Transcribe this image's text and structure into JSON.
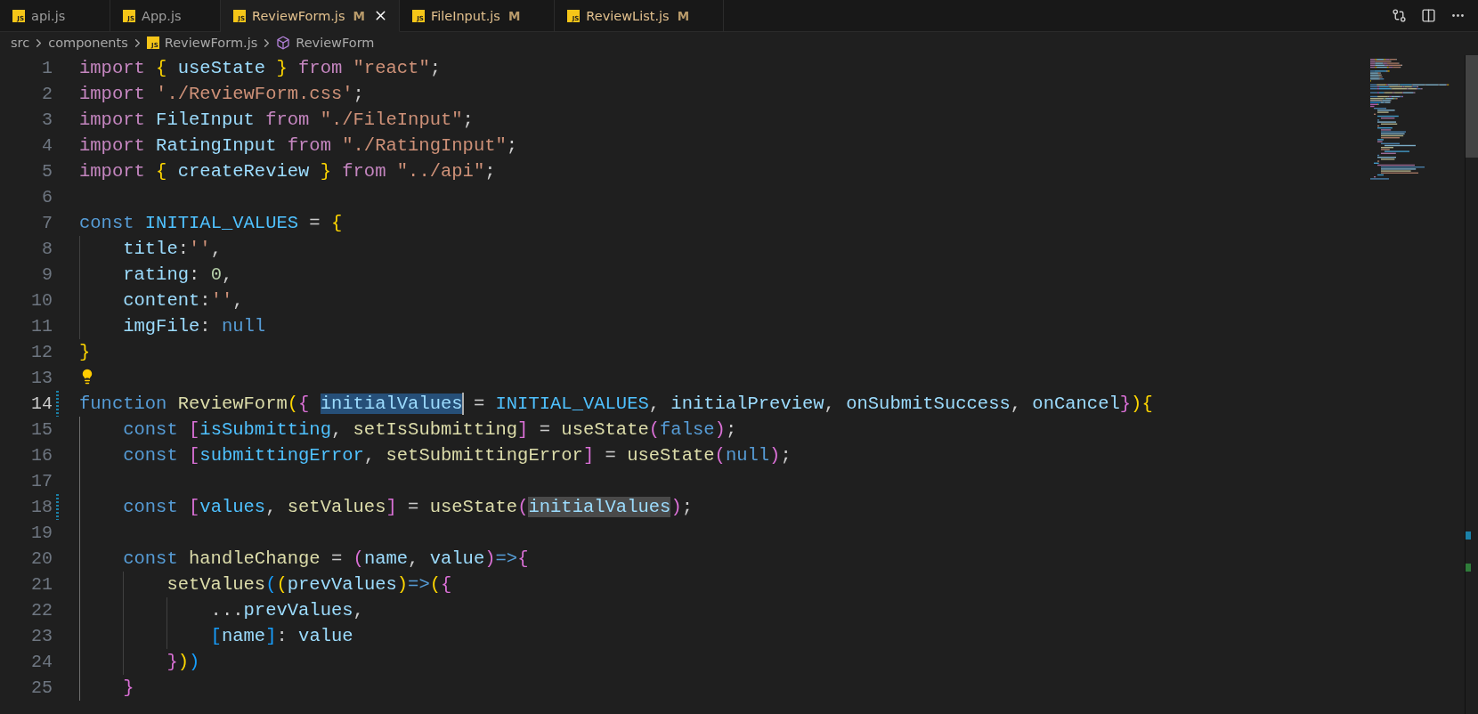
{
  "tabs": [
    {
      "label": "api.js",
      "icon_text": "JS",
      "modified": false,
      "selected": false
    },
    {
      "label": "App.js",
      "icon_text": "JS",
      "modified": false,
      "selected": false
    },
    {
      "label": "ReviewForm.js",
      "icon_text": "JS",
      "modified": true,
      "badge": "M",
      "selected": true
    },
    {
      "label": "FileInput.js",
      "icon_text": "JS",
      "modified": true,
      "badge": "M",
      "selected": false
    },
    {
      "label": "ReviewList.js",
      "icon_text": "JS",
      "modified": true,
      "badge": "M",
      "selected": false
    }
  ],
  "breadcrumbs": [
    {
      "kind": "folder",
      "label": "src"
    },
    {
      "kind": "folder",
      "label": "components"
    },
    {
      "kind": "file",
      "label": "ReviewForm.js",
      "icon_text": "JS"
    },
    {
      "kind": "symbol",
      "label": "ReviewForm"
    }
  ],
  "lines": [
    {
      "number": "1",
      "current": false,
      "modified": false,
      "lightbulb": false,
      "tokens": [
        {
          "text": "import",
          "kind": "keyword"
        },
        {
          "text": " {",
          "kind": "bracket1"
        },
        {
          "text": " useState",
          "kind": "variable"
        },
        {
          "text": " }",
          "kind": "bracket1"
        },
        {
          "text": " from",
          "kind": "keyword"
        },
        {
          "text": " \"react\"",
          "kind": "string"
        },
        {
          "text": ";",
          "kind": "plain"
        }
      ]
    },
    {
      "number": "2",
      "current": false,
      "modified": false,
      "lightbulb": false,
      "tokens": [
        {
          "text": "import",
          "kind": "keyword"
        },
        {
          "text": " './ReviewForm.css'",
          "kind": "string"
        },
        {
          "text": ";",
          "kind": "plain"
        }
      ]
    },
    {
      "number": "3",
      "current": false,
      "modified": false,
      "lightbulb": false,
      "tokens": [
        {
          "text": "import",
          "kind": "keyword"
        },
        {
          "text": " FileInput",
          "kind": "variable"
        },
        {
          "text": " from",
          "kind": "keyword"
        },
        {
          "text": " \"./FileInput\"",
          "kind": "string"
        },
        {
          "text": ";",
          "kind": "plain"
        }
      ]
    },
    {
      "number": "4",
      "current": false,
      "modified": false,
      "lightbulb": false,
      "tokens": [
        {
          "text": "import",
          "kind": "keyword"
        },
        {
          "text": " RatingInput",
          "kind": "variable"
        },
        {
          "text": " from",
          "kind": "keyword"
        },
        {
          "text": " \"./RatingInput\"",
          "kind": "string"
        },
        {
          "text": ";",
          "kind": "plain"
        }
      ]
    },
    {
      "number": "5",
      "current": false,
      "modified": false,
      "lightbulb": false,
      "tokens": [
        {
          "text": "import",
          "kind": "keyword"
        },
        {
          "text": " {",
          "kind": "bracket1"
        },
        {
          "text": " createReview",
          "kind": "variable"
        },
        {
          "text": " }",
          "kind": "bracket1"
        },
        {
          "text": " from",
          "kind": "keyword"
        },
        {
          "text": " \"../api\"",
          "kind": "string"
        },
        {
          "text": ";",
          "kind": "plain"
        }
      ]
    },
    {
      "number": "6",
      "current": false,
      "modified": false,
      "lightbulb": false
    },
    {
      "number": "7",
      "current": false,
      "modified": false,
      "lightbulb": false,
      "tokens": [
        {
          "text": "const",
          "kind": "storage"
        },
        {
          "text": " INITIAL_VALUES",
          "kind": "constant"
        },
        {
          "text": " =",
          "kind": "plain"
        },
        {
          "text": " {",
          "kind": "bracket1"
        }
      ]
    },
    {
      "number": "8",
      "current": false,
      "modified": false,
      "lightbulb": false,
      "tokens": [
        {
          "text": "    title",
          "kind": "variable"
        },
        {
          "text": ":",
          "kind": "plain"
        },
        {
          "text": "''",
          "kind": "string"
        },
        {
          "text": ",",
          "kind": "plain"
        }
      ]
    },
    {
      "number": "9",
      "current": false,
      "modified": false,
      "lightbulb": false,
      "tokens": [
        {
          "text": "    rating",
          "kind": "variable"
        },
        {
          "text": ":",
          "kind": "plain"
        },
        {
          "text": " 0",
          "kind": "number"
        },
        {
          "text": ",",
          "kind": "plain"
        }
      ]
    },
    {
      "number": "10",
      "current": false,
      "modified": false,
      "lightbulb": false,
      "tokens": [
        {
          "text": "    content",
          "kind": "variable"
        },
        {
          "text": ":",
          "kind": "plain"
        },
        {
          "text": "''",
          "kind": "string"
        },
        {
          "text": ",",
          "kind": "plain"
        }
      ]
    },
    {
      "number": "11",
      "current": false,
      "modified": false,
      "lightbulb": false,
      "tokens": [
        {
          "text": "    imgFile",
          "kind": "variable"
        },
        {
          "text": ":",
          "kind": "plain"
        },
        {
          "text": " null",
          "kind": "storage"
        }
      ]
    },
    {
      "number": "12",
      "current": false,
      "modified": false,
      "lightbulb": false,
      "tokens": [
        {
          "text": "}",
          "kind": "bracket1"
        }
      ]
    },
    {
      "number": "13",
      "current": false,
      "modified": false,
      "lightbulb": true
    },
    {
      "number": "14",
      "current": true,
      "modified": true,
      "lightbulb": false,
      "tokens": [
        {
          "text": "function",
          "kind": "storage"
        },
        {
          "text": " ReviewForm",
          "kind": "function"
        },
        {
          "text": "(",
          "kind": "bracket1"
        },
        {
          "text": "{ ",
          "kind": "bracket2"
        },
        {
          "text": "initialValues",
          "kind": "variable",
          "selected": true
        },
        {
          "text": " =",
          "kind": "plain"
        },
        {
          "text": " INITIAL_VALUES",
          "kind": "constant"
        },
        {
          "text": ",",
          "kind": "plain"
        },
        {
          "text": " initialPreview",
          "kind": "variable"
        },
        {
          "text": ",",
          "kind": "plain"
        },
        {
          "text": " onSubmitSuccess",
          "kind": "variable"
        },
        {
          "text": ",",
          "kind": "plain"
        },
        {
          "text": " onCancel",
          "kind": "variable"
        },
        {
          "text": "}",
          "kind": "bracket2"
        },
        {
          "text": ")",
          "kind": "bracket1"
        },
        {
          "text": "{",
          "kind": "bracket1"
        }
      ]
    },
    {
      "number": "15",
      "current": false,
      "modified": false,
      "lightbulb": false,
      "tokens": [
        {
          "text": "    const",
          "kind": "storage"
        },
        {
          "text": " [",
          "kind": "bracket2"
        },
        {
          "text": "isSubmitting",
          "kind": "constant"
        },
        {
          "text": ",",
          "kind": "plain"
        },
        {
          "text": " setIsSubmitting",
          "kind": "function"
        },
        {
          "text": "]",
          "kind": "bracket2"
        },
        {
          "text": " =",
          "kind": "plain"
        },
        {
          "text": " useState",
          "kind": "function"
        },
        {
          "text": "(",
          "kind": "bracket2"
        },
        {
          "text": "false",
          "kind": "storage"
        },
        {
          "text": ")",
          "kind": "bracket2"
        },
        {
          "text": ";",
          "kind": "plain"
        }
      ]
    },
    {
      "number": "16",
      "current": false,
      "modified": false,
      "lightbulb": false,
      "tokens": [
        {
          "text": "    const",
          "kind": "storage"
        },
        {
          "text": " [",
          "kind": "bracket2"
        },
        {
          "text": "submittingError",
          "kind": "constant"
        },
        {
          "text": ",",
          "kind": "plain"
        },
        {
          "text": " setSubmittingError",
          "kind": "function"
        },
        {
          "text": "]",
          "kind": "bracket2"
        },
        {
          "text": " =",
          "kind": "plain"
        },
        {
          "text": " useState",
          "kind": "function"
        },
        {
          "text": "(",
          "kind": "bracket2"
        },
        {
          "text": "null",
          "kind": "storage"
        },
        {
          "text": ")",
          "kind": "bracket2"
        },
        {
          "text": ";",
          "kind": "plain"
        }
      ]
    },
    {
      "number": "17",
      "current": false,
      "modified": false,
      "lightbulb": false
    },
    {
      "number": "18",
      "current": false,
      "modified": true,
      "lightbulb": false,
      "tokens": [
        {
          "text": "    const",
          "kind": "storage"
        },
        {
          "text": " [",
          "kind": "bracket2"
        },
        {
          "text": "values",
          "kind": "constant"
        },
        {
          "text": ",",
          "kind": "plain"
        },
        {
          "text": " setValues",
          "kind": "function"
        },
        {
          "text": "]",
          "kind": "bracket2"
        },
        {
          "text": " =",
          "kind": "plain"
        },
        {
          "text": " useState",
          "kind": "function"
        },
        {
          "text": "(",
          "kind": "bracket2"
        },
        {
          "text": "initialValues",
          "kind": "variable",
          "occurrence": true
        },
        {
          "text": ")",
          "kind": "bracket2"
        },
        {
          "text": ";",
          "kind": "plain"
        }
      ]
    },
    {
      "number": "19",
      "current": false,
      "modified": false,
      "lightbulb": false
    },
    {
      "number": "20",
      "current": false,
      "modified": false,
      "lightbulb": false,
      "tokens": [
        {
          "text": "    const",
          "kind": "storage"
        },
        {
          "text": " handleChange",
          "kind": "function"
        },
        {
          "text": " =",
          "kind": "plain"
        },
        {
          "text": " (",
          "kind": "bracket2"
        },
        {
          "text": "name",
          "kind": "variable"
        },
        {
          "text": ",",
          "kind": "plain"
        },
        {
          "text": " value",
          "kind": "variable"
        },
        {
          "text": ")",
          "kind": "bracket2"
        },
        {
          "text": "=>",
          "kind": "storage"
        },
        {
          "text": "{",
          "kind": "bracket2"
        }
      ]
    },
    {
      "number": "21",
      "current": false,
      "modified": false,
      "lightbulb": false,
      "tokens": [
        {
          "text": "        setValues",
          "kind": "function"
        },
        {
          "text": "(",
          "kind": "bracket3"
        },
        {
          "text": "(",
          "kind": "bracket1"
        },
        {
          "text": "prevValues",
          "kind": "variable"
        },
        {
          "text": ")",
          "kind": "bracket1"
        },
        {
          "text": "=>",
          "kind": "storage"
        },
        {
          "text": "(",
          "kind": "bracket1"
        },
        {
          "text": "{",
          "kind": "bracket2"
        }
      ]
    },
    {
      "number": "22",
      "current": false,
      "modified": false,
      "lightbulb": false,
      "tokens": [
        {
          "text": "            ...",
          "kind": "plain"
        },
        {
          "text": "prevValues",
          "kind": "variable"
        },
        {
          "text": ",",
          "kind": "plain"
        }
      ]
    },
    {
      "number": "23",
      "current": false,
      "modified": false,
      "lightbulb": false,
      "tokens": [
        {
          "text": "            [",
          "kind": "bracket3"
        },
        {
          "text": "name",
          "kind": "variable"
        },
        {
          "text": "]",
          "kind": "bracket3"
        },
        {
          "text": ":",
          "kind": "plain"
        },
        {
          "text": " value",
          "kind": "variable"
        }
      ]
    },
    {
      "number": "24",
      "current": false,
      "modified": false,
      "lightbulb": false,
      "tokens": [
        {
          "text": "        }",
          "kind": "bracket2"
        },
        {
          "text": ")",
          "kind": "bracket1"
        },
        {
          "text": ")",
          "kind": "bracket3"
        }
      ]
    },
    {
      "number": "25",
      "current": false,
      "modified": false,
      "lightbulb": false,
      "tokens": [
        {
          "text": "    }",
          "kind": "bracket2"
        }
      ]
    }
  ]
}
